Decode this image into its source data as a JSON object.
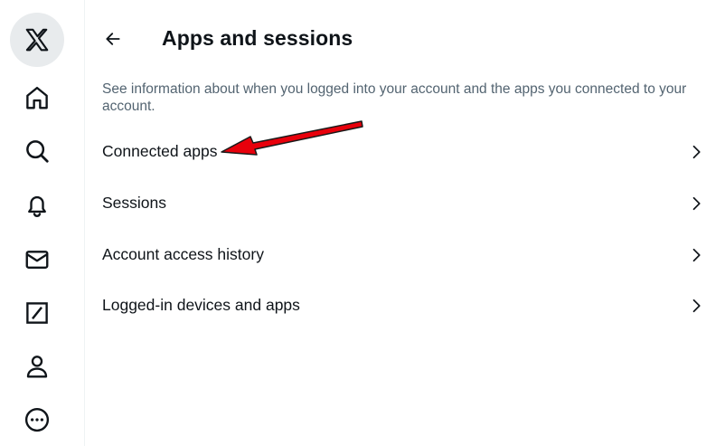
{
  "sidebar": {
    "items": [
      {
        "name": "x-logo-icon"
      },
      {
        "name": "home-icon"
      },
      {
        "name": "search-icon"
      },
      {
        "name": "notifications-bell-icon"
      },
      {
        "name": "messages-envelope-icon"
      },
      {
        "name": "grok-slash-icon"
      },
      {
        "name": "profile-person-icon"
      },
      {
        "name": "more-options-icon"
      }
    ]
  },
  "header": {
    "title": "Apps and sessions",
    "back_icon": "arrow-left-icon"
  },
  "description": "See information about when you logged into your account and the apps you connected to your account.",
  "menu": {
    "items": [
      {
        "label": "Connected apps"
      },
      {
        "label": "Sessions"
      },
      {
        "label": "Account access history"
      },
      {
        "label": "Logged-in devices and apps"
      }
    ]
  },
  "annotation": {
    "type": "red-arrow",
    "color": "#e8000b",
    "points_to": "Connected apps"
  },
  "colors": {
    "text_primary": "#0f1419",
    "text_secondary": "#536471",
    "logo_bg": "#e8ebed",
    "divider": "#eff3f4"
  }
}
